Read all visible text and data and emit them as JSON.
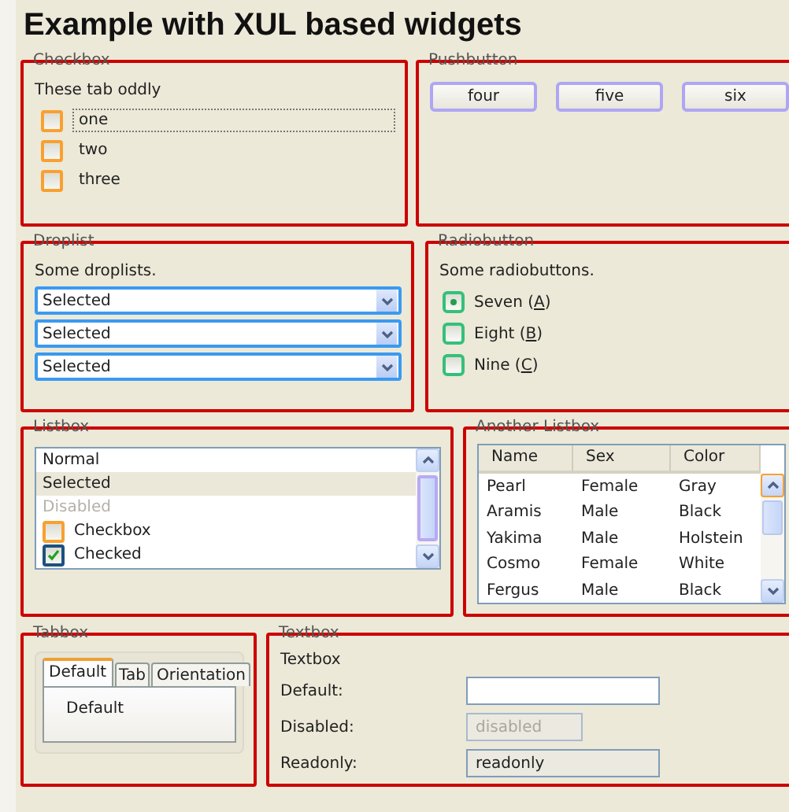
{
  "title": "Example with XUL based widgets",
  "checkbox_group": {
    "caption": "Checkbox",
    "description": "These tab oddly",
    "items": [
      {
        "label": "one",
        "checked": false,
        "focused": true
      },
      {
        "label": "two",
        "checked": false,
        "focused": false
      },
      {
        "label": "three",
        "checked": false,
        "focused": false
      }
    ]
  },
  "pushbutton_group": {
    "caption": "Pushbutton",
    "buttons": [
      "four",
      "five",
      "six"
    ]
  },
  "droplist_group": {
    "caption": "Droplist",
    "description": "Some droplists.",
    "droplists": [
      {
        "value": "Selected"
      },
      {
        "value": "Selected"
      },
      {
        "value": "Selected"
      }
    ]
  },
  "radio_group": {
    "caption": "Radiobutton",
    "description": "Some radiobuttons.",
    "items": [
      {
        "label": "Seven (",
        "access_key": "A",
        "label_end": ")",
        "selected": true
      },
      {
        "label": "Eight (",
        "access_key": "B",
        "label_end": ")",
        "selected": false
      },
      {
        "label": "Nine (",
        "access_key": "C",
        "label_end": ")",
        "selected": false
      }
    ]
  },
  "listbox_group": {
    "caption": "Listbox",
    "items": [
      {
        "kind": "text",
        "label": "Normal",
        "selected": false,
        "disabled": false
      },
      {
        "kind": "text",
        "label": "Selected",
        "selected": true,
        "disabled": false
      },
      {
        "kind": "text",
        "label": "Disabled",
        "selected": false,
        "disabled": true
      },
      {
        "kind": "checkbox",
        "label": "Checkbox",
        "checked": false,
        "selected": false,
        "disabled": false
      },
      {
        "kind": "checkbox",
        "label": "Checked",
        "checked": true,
        "selected": false,
        "disabled": false
      }
    ]
  },
  "another_listbox_group": {
    "caption": "Another Listbox",
    "columns": [
      "Name",
      "Sex",
      "Color"
    ],
    "rows": [
      [
        "Pearl",
        "Female",
        "Gray"
      ],
      [
        "Aramis",
        "Male",
        "Black"
      ],
      [
        "Yakima",
        "Male",
        "Holstein"
      ],
      [
        "Cosmo",
        "Female",
        "White"
      ],
      [
        "Fergus",
        "Male",
        "Black"
      ]
    ]
  },
  "tabbox_group": {
    "caption": "Tabbox",
    "tabs": [
      {
        "label": "Default",
        "selected": true
      },
      {
        "label": "Tab",
        "selected": false
      },
      {
        "label": "Orientation",
        "selected": false
      }
    ],
    "panel_text": "Default"
  },
  "textbox_group": {
    "caption": "Textbox",
    "heading": "Textbox",
    "fields": [
      {
        "label": "Default:",
        "disabled": false,
        "readonly": false
      },
      {
        "label": "Disabled:",
        "value": "disabled",
        "disabled": true,
        "readonly": false
      },
      {
        "label": "Readonly:",
        "value": "readonly",
        "disabled": false,
        "readonly": true
      }
    ]
  }
}
